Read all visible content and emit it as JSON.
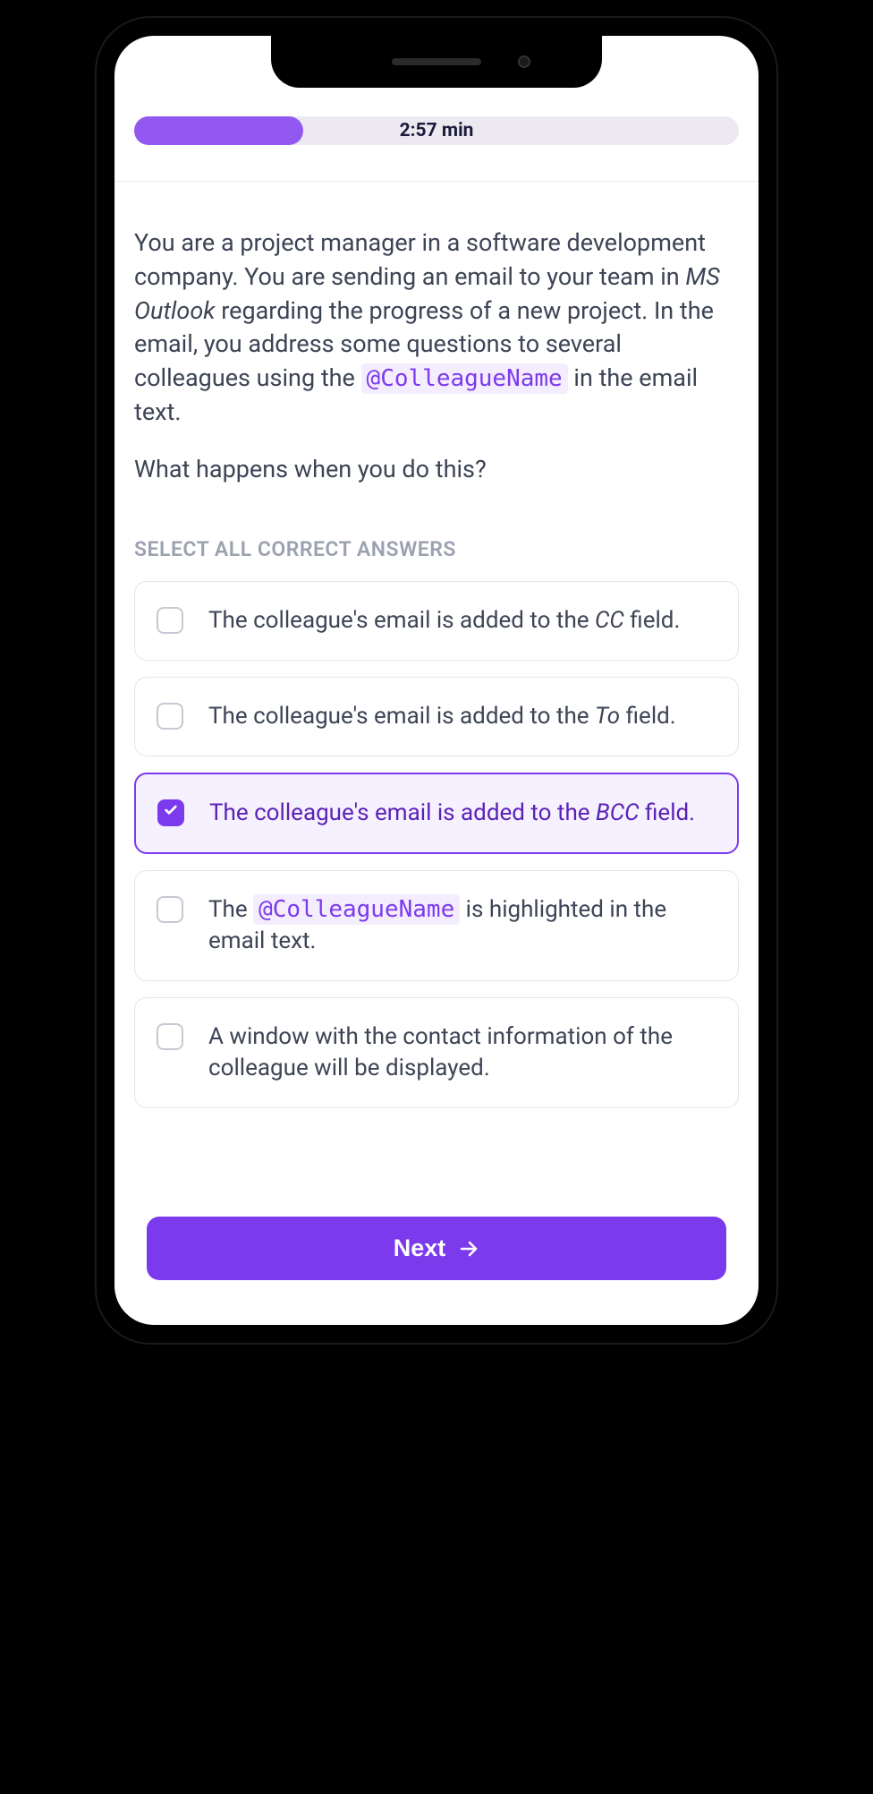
{
  "progress": {
    "timer_text": "2:57 min",
    "fill_percent": 28
  },
  "question": {
    "scenario_pre": "You are a project manager in a software development company. You are sending an email to your team in ",
    "scenario_app": "MS Outlook",
    "scenario_mid": " regarding the progress of a new project. In the email, you address some questions to several colleagues using the ",
    "mention_token": "@ColleagueName",
    "scenario_post": " in the email text.",
    "followup": "What happens when you do this?"
  },
  "instruction": "SELECT ALL CORRECT ANSWERS",
  "options": [
    {
      "pre": "The colleague's email is added to the ",
      "em": "CC",
      "post": " field.",
      "selected": false,
      "has_mention": false
    },
    {
      "pre": "The colleague's email is added to the ",
      "em": "To",
      "post": " field.",
      "selected": false,
      "has_mention": false
    },
    {
      "pre": "The colleague's email is added to the ",
      "em": "BCC",
      "post": " field.",
      "selected": true,
      "has_mention": false
    },
    {
      "pre": "The ",
      "mention": "@ColleagueName",
      "post": " is highlighted in the email text.",
      "selected": false,
      "has_mention": true
    },
    {
      "pre": "A window with the contact information of the colleague will be displayed.",
      "em": "",
      "post": "",
      "selected": false,
      "has_mention": false
    }
  ],
  "footer": {
    "next_label": "Next"
  },
  "colors": {
    "accent": "#7c3aed",
    "accent_light": "#9358ef"
  }
}
